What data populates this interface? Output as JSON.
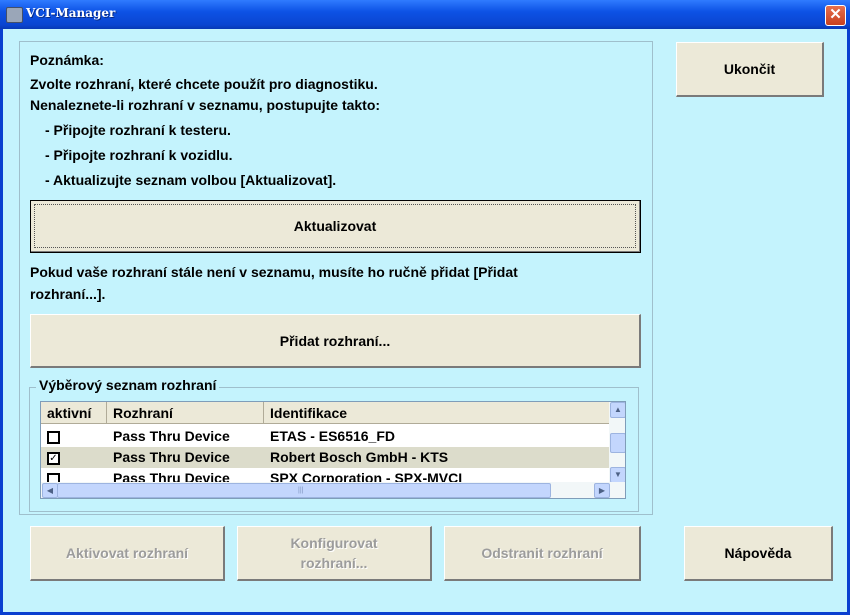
{
  "window": {
    "title": "VCI-Manager",
    "close_glyph": "✕"
  },
  "note": {
    "heading": "Poznámka:",
    "line1": "Zvolte rozhraní, které chcete použít pro diagnostiku.",
    "line2": "Nenaleznete-li rozhraní v seznamu, postupujte takto:",
    "step1": "- Připojte rozhraní k testeru.",
    "step2": "- Připojte rozhraní k vozidlu.",
    "step3": "- Aktualizujte seznam volbou [Aktualizovat]."
  },
  "buttons": {
    "close": "Ukončit",
    "refresh": "Aktualizovat",
    "add": "Přidat rozhraní...",
    "activate": "Aktivovat rozhraní",
    "configure": "Konfigurovat rozhraní...",
    "remove": "Odstranit rozhraní",
    "help": "Nápověda"
  },
  "manual": {
    "line1": "Pokud vaše rozhraní stále není v seznamu, musíte ho ručně přidat [Přidat",
    "line2": "rozhraní...]."
  },
  "list": {
    "group_label": "Výběrový seznam rozhraní",
    "columns": [
      "aktivní",
      "Rozhraní",
      "Identifikace"
    ],
    "rows": [
      {
        "checked": false,
        "interface": "Pass Thru Device",
        "identification": "ETAS - ES6516_FD"
      },
      {
        "checked": true,
        "interface": "Pass Thru Device",
        "identification": "Robert Bosch GmbH - KTS"
      },
      {
        "checked": false,
        "interface": "Pass Thru Device",
        "identification": "SPX Corporation - SPX-MVCI"
      }
    ]
  },
  "icons": {
    "app": "app-icon",
    "close": "close-icon",
    "checkbox_checked": "✓"
  },
  "colors": {
    "window_bg": "#c4f3fd",
    "titlebar": "#0a45d1",
    "button_face": "#ece9d8"
  }
}
